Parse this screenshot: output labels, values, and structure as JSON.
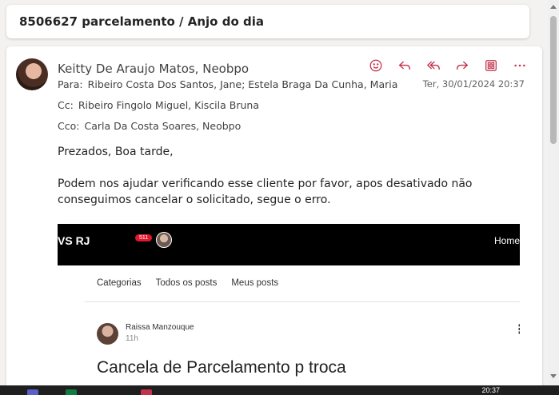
{
  "subject": "8506627 parcelamento / Anjo do dia",
  "email": {
    "sender": "Keitty De Araujo Matos, Neobpo",
    "to_label": "Para:",
    "to": "Ribeiro Costa Dos Santos, Jane;  Estela Braga Da Cunha, Maria",
    "cc_label": "Cc:",
    "cc": "Ribeiro Fingolo Miguel, Kiscila Bruna",
    "bcc_label": "Cco:",
    "bcc": "Carla Da Costa Soares, Neobpo",
    "date": "Ter, 30/01/2024 20:37",
    "greeting": "Prezados, Boa tarde,",
    "body": "Podem nos ajudar verificando esse cliente por favor, apos desativado não conseguimos cancelar o solicitado, segue o erro."
  },
  "actions": [
    {
      "name": "emoji-react-icon"
    },
    {
      "name": "reply-icon"
    },
    {
      "name": "reply-all-icon"
    },
    {
      "name": "forward-icon"
    },
    {
      "name": "apps-icon"
    },
    {
      "name": "more-icon"
    }
  ],
  "embedded_screenshot": {
    "brand": "VS RJ",
    "badge": "511",
    "nav_home": "Home",
    "tabs": [
      "Categorias",
      "Todos os posts",
      "Meus posts"
    ],
    "post_author": "Raissa Manzouque",
    "post_time": "11h",
    "post_title": "Cancela de Parcelamento p troca"
  },
  "taskbar": {
    "time": "20:37"
  },
  "colors": {
    "accent": "#c4314b",
    "embed_bar": "#000000",
    "badge": "#e0182d"
  }
}
